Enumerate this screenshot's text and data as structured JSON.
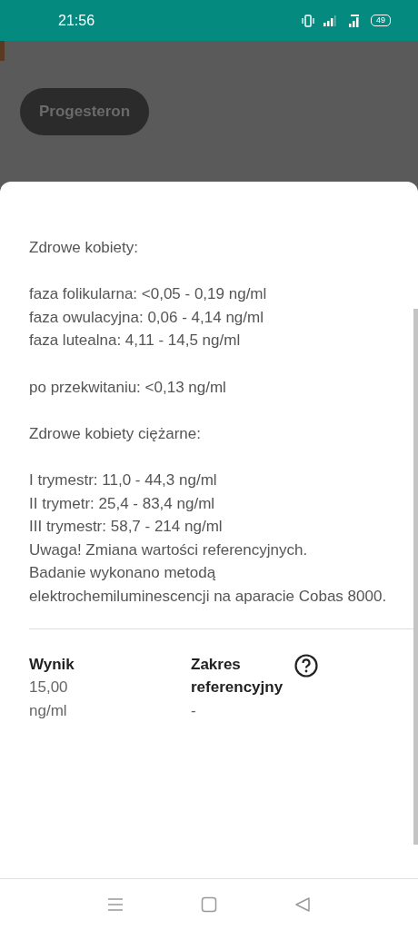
{
  "status_bar": {
    "time": "21:56",
    "battery": "49"
  },
  "background": {
    "chip": "Progesteron"
  },
  "sheet": {
    "paragraphs": [
      [
        "Zdrowe kobiety:"
      ],
      [
        "faza folikularna: <0,05 - 0,19 ng/ml",
        "faza owulacyjna: 0,06 - 4,14 ng/ml",
        "faza lutealna: 4,11 - 14,5 ng/ml"
      ],
      [
        "po przekwitaniu: <0,13 ng/ml"
      ],
      [
        "Zdrowe kobiety ciężarne:"
      ],
      [
        "I trymestr: 11,0 - 44,3 ng/ml",
        "II trymetr: 25,4 - 83,4 ng/ml",
        "III trymestr: 58,7 - 214 ng/ml",
        "Uwaga! Zmiana wartości referencyjnych.",
        "Badanie wykonano metodą elektrochemiluminescencji na aparacie Cobas 8000."
      ]
    ],
    "result": {
      "label": "Wynik",
      "value": "15,00 ng/ml"
    },
    "range": {
      "label": "Zakres referencyjny",
      "value": "-"
    }
  }
}
